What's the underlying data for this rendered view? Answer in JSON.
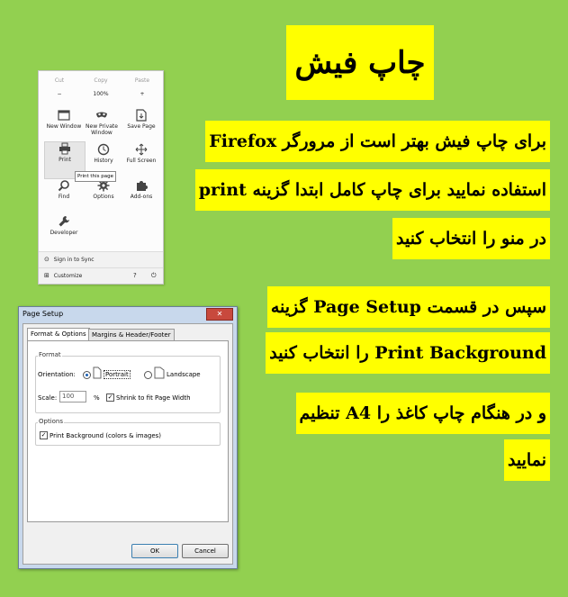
{
  "title": "چاپ فیش",
  "instructions": [
    "برای چاپ فیش بهتر است از مرورگر Firefox",
    "استفاده نمایید برای چاپ کامل ابتدا گزینه print",
    "در منو را انتخاب کنید",
    "سپس در قسمت Page Setup گزینه",
    "Print Background را انتخاب کنید",
    "و در هنگام چاپ کاغذ را A4 تنظیم",
    "نمایید"
  ],
  "firefox_menu": {
    "cut": "Cut",
    "copy": "Copy",
    "paste": "Paste",
    "zoom_out": "−",
    "zoom_level": "100%",
    "zoom_in": "+",
    "new_window": "New Window",
    "new_private_window": "New Private Window",
    "save_page": "Save Page",
    "print": "Print",
    "history": "History",
    "full_screen": "Full Screen",
    "find": "Find",
    "options": "Options",
    "addons": "Add-ons",
    "developer": "Developer",
    "print_tooltip": "Print this page",
    "sign_in": "Sign in to Sync",
    "customize": "Customize"
  },
  "page_setup": {
    "window_title": "Page Setup",
    "close": "✕",
    "tab_format": "Format & Options",
    "tab_margins": "Margins & Header/Footer",
    "format_group": "Format",
    "orientation_label": "Orientation:",
    "portrait": "Portrait",
    "landscape": "Landscape",
    "scale_label": "Scale:",
    "scale_value": "100",
    "percent": "%",
    "shrink_label": "Shrink to fit Page Width",
    "options_group": "Options",
    "print_bg_label": "Print Background (colors & images)",
    "ok": "OK",
    "cancel": "Cancel"
  },
  "colors": {
    "background": "#92d050",
    "highlight": "#ffff00"
  }
}
